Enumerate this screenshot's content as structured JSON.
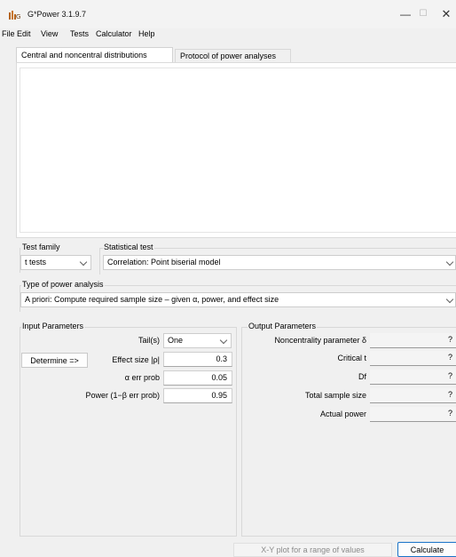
{
  "window": {
    "title": "G*Power 3.1.9.7",
    "min_glyph": "—",
    "max_glyph": "☐",
    "close_glyph": "✕"
  },
  "menu": [
    "File",
    "Edit",
    "View",
    "Tests",
    "Calculator",
    "Help"
  ],
  "tabs": {
    "central": "Central and noncentral distributions",
    "protocol": "Protocol of power analyses"
  },
  "test_family": {
    "label": "Test family",
    "value": "t tests"
  },
  "statistical_test": {
    "label": "Statistical test",
    "value": "Correlation: Point biserial model"
  },
  "power_analysis": {
    "label": "Type of power analysis",
    "value": "A priori: Compute required sample size – given α, power, and effect size"
  },
  "input": {
    "title": "Input Parameters",
    "tails_label": "Tail(s)",
    "tails_value": "One",
    "determine_label": "Determine =>",
    "effect_label": "Effect size |ρ|",
    "effect_value": "0.3",
    "alpha_label": "α err prob",
    "alpha_value": "0.05",
    "power_label": "Power (1−β err prob)",
    "power_value": "0.95"
  },
  "output": {
    "title": "Output Parameters",
    "noncentrality_label": "Noncentrality parameter δ",
    "noncentrality_value": "?",
    "critical_label": "Critical t",
    "critical_value": "?",
    "df_label": "Df",
    "df_value": "?",
    "sample_label": "Total sample size",
    "sample_value": "?",
    "actual_power_label": "Actual power",
    "actual_power_value": "?"
  },
  "buttons": {
    "xy_plot": "X-Y plot for a range of values",
    "calculate": "Calculate"
  },
  "colors": {
    "window_bg": "#f0f0f0",
    "field_bg": "#ffffff",
    "icon_accent": "#b5651d",
    "calculate_border": "#1a73c8"
  }
}
